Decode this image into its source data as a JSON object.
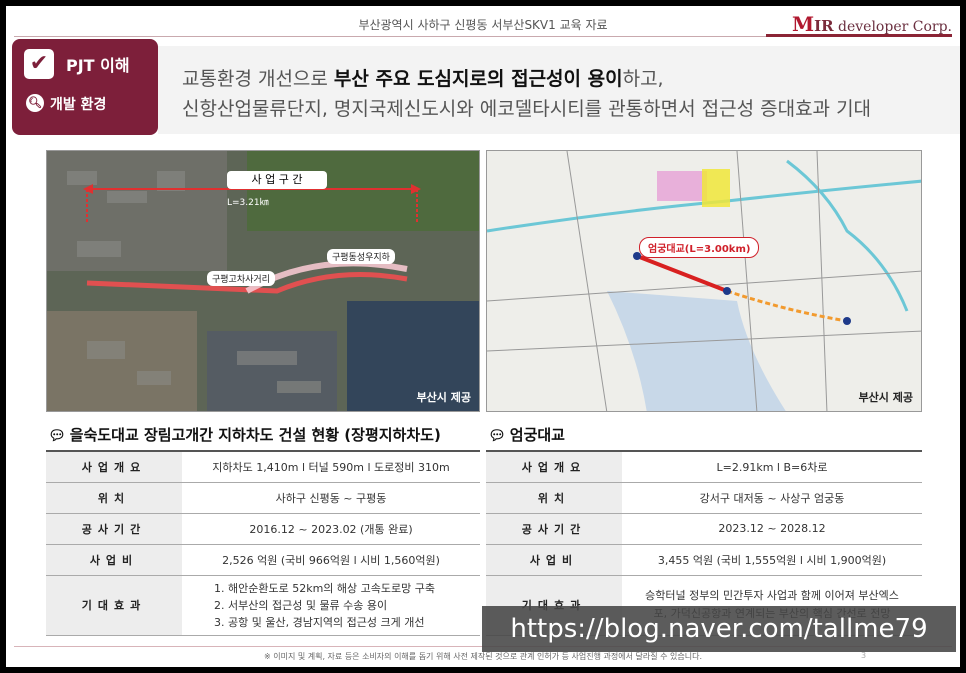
{
  "header": {
    "doc_title": "부산광역시 사하구 신평동 서부산SKV1 교육 자료",
    "logo_initial": "M",
    "logo_mid": "IR",
    "logo_rest": " developer Corp."
  },
  "badge": {
    "pjt_label": "PJT 이해",
    "env_label": "개발 환경"
  },
  "headline": {
    "line1_prefix": "교통환경 개선으로 ",
    "line1_bold": "부산 주요 도심지로의 접근성이 용이",
    "line1_suffix": "하고,",
    "line2": "신항산업물류단지, 명지국제신도시와 에코델타시티를 관통하면서 접근성 증대효과 기대"
  },
  "map_left": {
    "section_label": "사 업 구 간",
    "length_label": "L=3.21㎞",
    "label_a": "구평동성우지하",
    "label_b": "구평고차사거리",
    "credit": "부산시 제공"
  },
  "map_right": {
    "bridge_label": "엄궁대교(L=3.00km)",
    "credit": "부산시 제공"
  },
  "left_table": {
    "title": "을숙도대교 장림고개간 지하차도 건설 현황 (장평지하차도)",
    "rows": [
      {
        "label": "사업개요",
        "value": "지하차도 1,410m l 터널 590m l 도로정비 310m"
      },
      {
        "label": "위치",
        "value": "사하구 신평동 ~ 구평동"
      },
      {
        "label": "공사기간",
        "value": "2016.12 ~ 2023.02 (개통 완료)"
      },
      {
        "label": "사업비",
        "value": "2,526 억원 (국비 966억원 l 시비 1,560억원)"
      }
    ],
    "effects_label": "기대효과",
    "effects": [
      "1. 해안순환도로 52km의 해상 고속도로망 구축",
      "2. 서부산의 접근성 및 물류 수송 용이",
      "3. 공항 및 울산, 경남지역의 접근성 크게 개선"
    ]
  },
  "right_table": {
    "title": "엄궁대교",
    "rows": [
      {
        "label": "사업개요",
        "value": "L=2.91km l B=6차로"
      },
      {
        "label": "위치",
        "value": "강서구 대저동 ~ 사상구 엄궁동"
      },
      {
        "label": "공사기간",
        "value": "2023.12 ~ 2028.12"
      },
      {
        "label": "사업비",
        "value": "3,455 억원 (국비 1,555억원 l 시비 1,900억원)"
      }
    ],
    "effects_label": "기대효과",
    "effects": "승학터널 정부의 민간투자 사업과 함께 이어져 부산엑스포, 가덕신공항과 연계되는 부산의 핵심 간선로 전망"
  },
  "footnote": "※ 이미지 및 계획, 자료 등은 소비자의 이해를 돕기 위해 사전 제작된 것으로 관계 인허가 등 사업진행 과정에서 달라질 수 있습니다.",
  "page_number": "3",
  "watermark": "https://blog.naver.com/tallme79"
}
